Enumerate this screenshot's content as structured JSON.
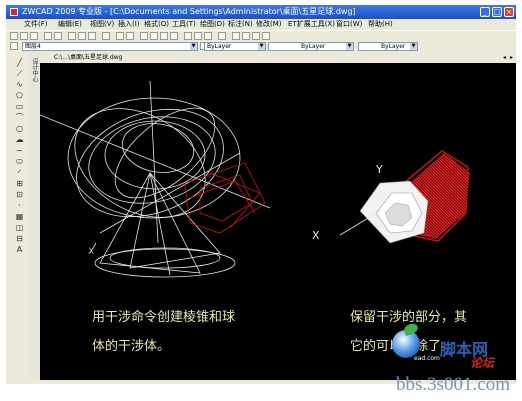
{
  "window": {
    "title": "ZWCAD 2009 专业版 - [C:\\Documents and Settings\\Administrator\\桌面\\五星足球.dwg]"
  },
  "menu": {
    "items": [
      "文件(F)",
      "编辑(E)",
      "视图(V)",
      "插入(I)",
      "格式(O)",
      "工具(T)",
      "绘图(D)",
      "标注(N)",
      "修改(M)",
      "ET扩展工具(X)",
      "窗口(W)",
      "帮助(H)"
    ]
  },
  "toolbar2": {
    "layer": "图层4",
    "color": "ByLayer",
    "linetype": "ByLayer",
    "lineweight": "ByLayer"
  },
  "sidebar": {
    "label": "设计中心"
  },
  "document": {
    "path": "C:\\...\\桌面\\五星足球.dwg"
  },
  "canvas": {
    "caption_left_line1": "用干涉命令创建棱锥和球",
    "caption_left_line2": "体的干涉体。",
    "caption_right_line1": "保留干涉的部分，其",
    "caption_right_line2": "它的可以删除了。",
    "axis_y": "Y",
    "axis_x": "X",
    "axis_x2": "X",
    "axis_y2": "Y"
  },
  "watermark": {
    "site_cn": "脚本网",
    "site_sub": "论坛",
    "url": "bbs.3s001.com",
    "small": "ead.com"
  },
  "colors": {
    "canvas_bg": "#000000",
    "wire": "#e6e6e6",
    "red": "#cc1111",
    "caption": "#e8e8a8"
  }
}
